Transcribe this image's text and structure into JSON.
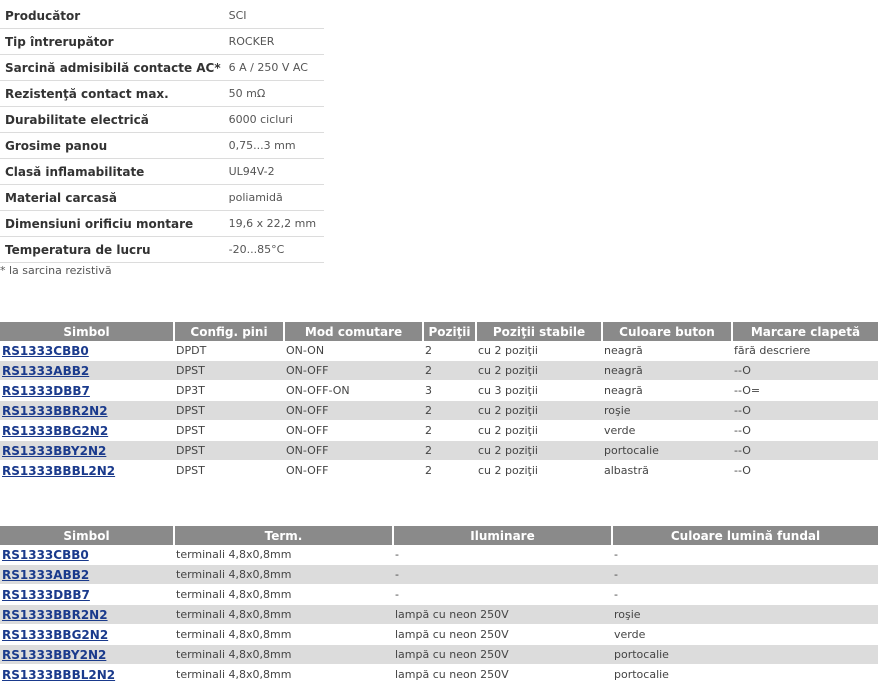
{
  "specs": [
    {
      "label": "Producător",
      "value": "SCI"
    },
    {
      "label": "Tip întrerupător",
      "value": "ROCKER"
    },
    {
      "label": "Sarcină admisibilă contacte AC*",
      "value": "6 A / 250 V AC"
    },
    {
      "label": "Rezistenţă contact max.",
      "value": "50 mΩ"
    },
    {
      "label": "Durabilitate electrică",
      "value": "6000 cicluri"
    },
    {
      "label": "Grosime panou",
      "value": "0,75...3 mm"
    },
    {
      "label": "Clasă inflamabilitate",
      "value": "UL94V-2"
    },
    {
      "label": "Material carcasă",
      "value": "poliamidă"
    },
    {
      "label": "Dimensiuni orificiu montare",
      "value": "19,6 x 22,2 mm"
    },
    {
      "label": "Temperatura de lucru",
      "value": "-20...85°C"
    }
  ],
  "footnote": "* la sarcina rezistivă",
  "table1": {
    "headers": [
      "Simbol",
      "Config. pini",
      "Mod comutare",
      "Poziţii",
      "Poziţii stabile",
      "Culoare buton",
      "Marcare clapetă"
    ],
    "rows": [
      [
        "RS1333CBB0",
        "DPDT",
        "ON-ON",
        "2",
        "cu 2 poziţii",
        "neagră",
        "fără descriere"
      ],
      [
        "RS1333ABB2",
        "DPST",
        "ON-OFF",
        "2",
        "cu 2 poziţii",
        "neagră",
        "--O"
      ],
      [
        "RS1333DBB7",
        "DP3T",
        "ON-OFF-ON",
        "3",
        "cu 3 poziţii",
        "neagră",
        "--O="
      ],
      [
        "RS1333BBR2N2",
        "DPST",
        "ON-OFF",
        "2",
        "cu 2 poziţii",
        "roşie",
        "--O"
      ],
      [
        "RS1333BBG2N2",
        "DPST",
        "ON-OFF",
        "2",
        "cu 2 poziţii",
        "verde",
        "--O"
      ],
      [
        "RS1333BBY2N2",
        "DPST",
        "ON-OFF",
        "2",
        "cu 2 poziţii",
        "portocalie",
        "--O"
      ],
      [
        "RS1333BBBL2N2",
        "DPST",
        "ON-OFF",
        "2",
        "cu 2 poziţii",
        "albastră",
        "--O"
      ]
    ]
  },
  "table2": {
    "headers": [
      "Simbol",
      "Term.",
      "Iluminare",
      "Culoare lumină fundal"
    ],
    "rows": [
      [
        "RS1333CBB0",
        "terminali 4,8x0,8mm",
        "-",
        "-"
      ],
      [
        "RS1333ABB2",
        "terminali 4,8x0,8mm",
        "-",
        "-"
      ],
      [
        "RS1333DBB7",
        "terminali 4,8x0,8mm",
        "-",
        "-"
      ],
      [
        "RS1333BBR2N2",
        "terminali 4,8x0,8mm",
        "lampă cu neon 250V",
        "roşie"
      ],
      [
        "RS1333BBG2N2",
        "terminali 4,8x0,8mm",
        "lampă cu neon 250V",
        "verde"
      ],
      [
        "RS1333BBY2N2",
        "terminali 4,8x0,8mm",
        "lampă cu neon 250V",
        "portocalie"
      ],
      [
        "RS1333BBBL2N2",
        "terminali 4,8x0,8mm",
        "lampă cu neon 250V",
        "portocalie"
      ]
    ]
  },
  "colors": {
    "header_bg": "#8a8a8a",
    "alt_row": "#dcdcdc",
    "link": "#1a3a8c"
  }
}
